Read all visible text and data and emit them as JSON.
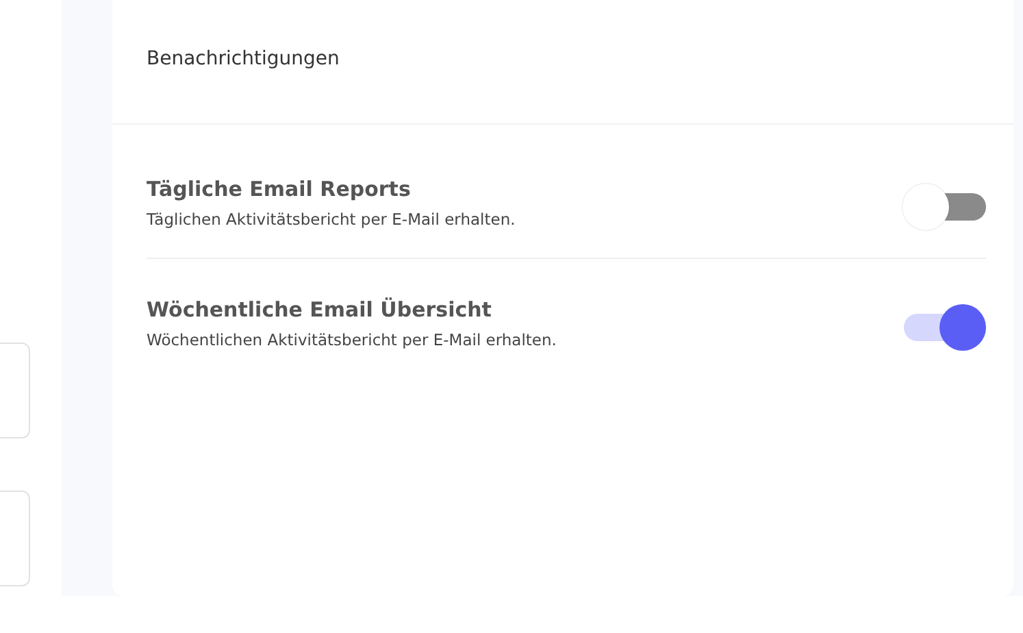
{
  "card": {
    "title": "Benachrichtigungen",
    "settings": [
      {
        "title": "Tägliche Email Reports",
        "description": "Täglichen Aktivitätsbericht per E-Mail erhalten.",
        "on": false
      },
      {
        "title": "Wöchentliche Email Übersicht",
        "description": "Wöchentlichen Aktivitätsbericht per E-Mail erhalten.",
        "on": true
      }
    ]
  }
}
